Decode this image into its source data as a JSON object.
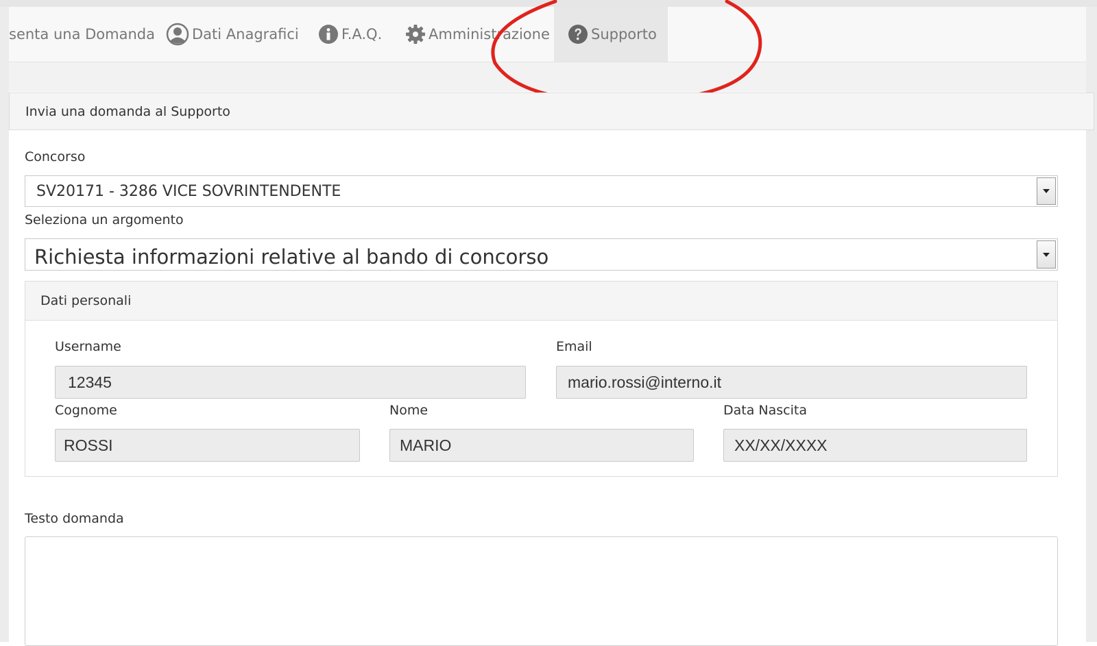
{
  "nav": {
    "items": [
      {
        "label": "senta una Domanda",
        "icon": null
      },
      {
        "label": "Dati Anagrafici",
        "icon": "user-circle-icon"
      },
      {
        "label": "F.A.Q.",
        "icon": "info-circle-icon"
      },
      {
        "label": "Amministrazione",
        "icon": "gear-icon"
      },
      {
        "label": "Supporto",
        "icon": "question-circle-icon",
        "active": true
      }
    ]
  },
  "form": {
    "panel_title": "Invia una domanda al Supporto",
    "concorso_label": "Concorso",
    "concorso_value": "SV20171 - 3286 VICE SOVRINTENDENTE",
    "argomento_label": "Seleziona un argomento",
    "argomento_value": "Richiesta informazioni relative al bando di concorso",
    "personal": {
      "title": "Dati personali",
      "username_label": "Username",
      "username_value": "12345",
      "email_label": "Email",
      "email_value": "mario.rossi@interno.it",
      "cognome_label": "Cognome",
      "cognome_value": "ROSSI",
      "nome_label": "Nome",
      "nome_value": "MARIO",
      "nascita_label": "Data Nascita",
      "nascita_value": "XX/XX/XXXX"
    },
    "testo_label": "Testo domanda"
  },
  "colors": {
    "annotation_circle": "#e0231c",
    "nav_text": "#777777",
    "nav_active_bg": "#e7e7e7"
  }
}
